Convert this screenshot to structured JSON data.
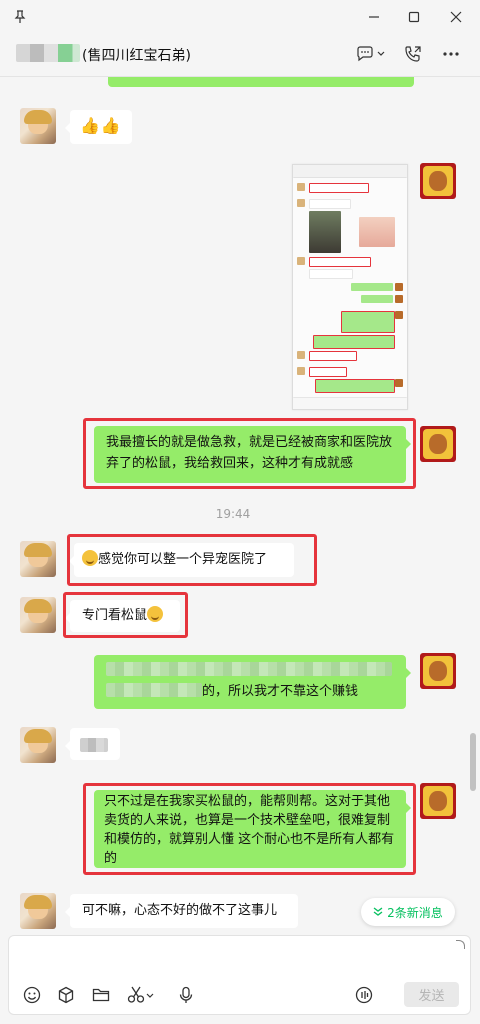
{
  "titlebar": {
    "pin_icon": "pin-icon",
    "minimize_icon": "minimize-icon",
    "maximize_icon": "maximize-icon",
    "close_icon": "close-icon"
  },
  "header": {
    "contact_name": "(售四川红宝石弟)",
    "chat_info_icon": "chat-bubble-icon",
    "call_icon": "phone-call-icon",
    "more_icon": "more-icon"
  },
  "messages": {
    "m1_text": "👍👍",
    "m3_text": "我最擅长的就是做急救，就是已经被商家和医院放弃了的松鼠，我给救回来，这种才有成就感",
    "timestamp": "19:44",
    "m4_text": "感觉你可以整一个异宠医院了",
    "m5_text": "专门看松鼠",
    "m6_tail": "的，所以我才不靠这个赚钱",
    "m8_text": "只不过是在我家买松鼠的，能帮则帮。这对于其他卖货的人来说，也算是一个技术壁垒吧，很难复制和模仿的，就算别人懂 这个耐心也不是所有人都有的",
    "m9_text": "可不嘛，心态不好的做不了这事儿"
  },
  "new_messages": {
    "label": "2条新消息",
    "icon": "double-chevron-down-icon"
  },
  "toolbar": {
    "emoji_icon": "emoji-icon",
    "favorites_icon": "cube-icon",
    "file_icon": "folder-icon",
    "screenshot_icon": "scissors-icon",
    "voice_icon": "microphone-icon",
    "voice_call_icon": "audio-icon",
    "send_label": "发送"
  },
  "colors": {
    "bubble_green": "#95ec69",
    "highlight_red": "#e5343c",
    "accent_green": "#07c160"
  }
}
